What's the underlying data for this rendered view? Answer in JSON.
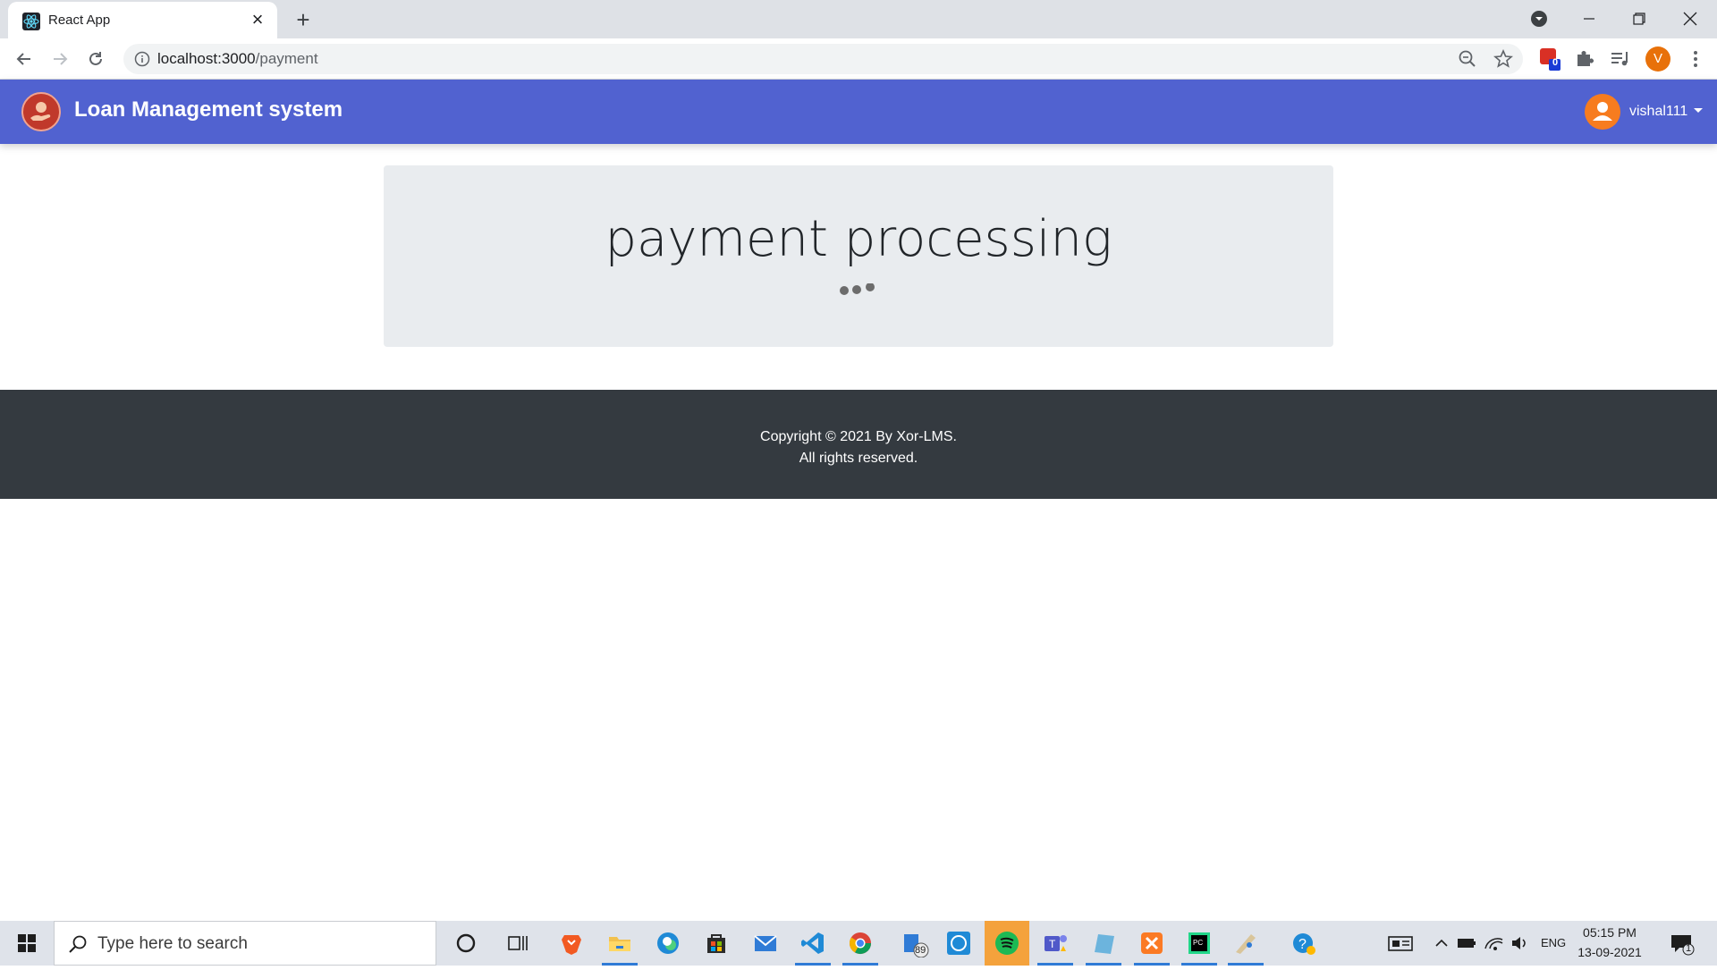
{
  "browser": {
    "tab_title": "React App",
    "url_host": "localhost:3000",
    "url_path": "/payment",
    "profile_initial": "V",
    "extension_badge": "0"
  },
  "navbar": {
    "brand": "Loan Management system",
    "username": "vishal111"
  },
  "main": {
    "heading": "payment processing"
  },
  "footer": {
    "line1": "Copyright © 2021 By Xor-LMS.",
    "line2": "All rights reserved."
  },
  "taskbar": {
    "search_placeholder": "Type here to search",
    "files_badge": "89",
    "language": "ENG",
    "time": "05:15 PM",
    "date": "13-09-2021",
    "notifications": "1"
  },
  "colors": {
    "navbar": "#5162d0",
    "card": "#e9ecef",
    "footer": "#343a40",
    "avatar": "#f77c1f"
  }
}
